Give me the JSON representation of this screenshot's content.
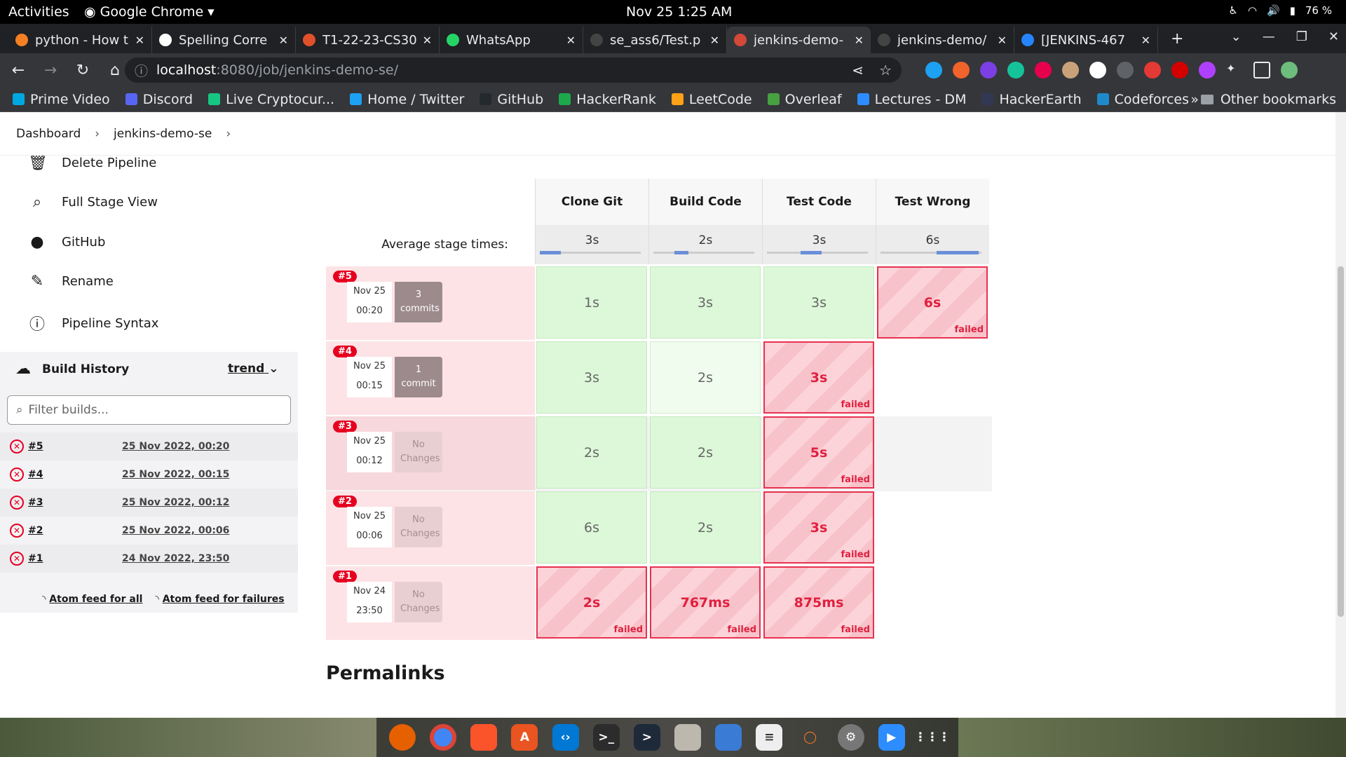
{
  "system": {
    "activities": "Activities",
    "app": "Google Chrome",
    "clock": "Nov 25  1:25 AM",
    "battery": "76 %"
  },
  "tabs": [
    {
      "title": "python - How t",
      "color": "#f48024"
    },
    {
      "title": "Spelling Corre",
      "color": "#ffffff"
    },
    {
      "title": "T1-22-23-CS30",
      "color": "#e0502a"
    },
    {
      "title": "WhatsApp",
      "color": "#25d366"
    },
    {
      "title": "se_ass6/Test.p",
      "color": "#444444"
    },
    {
      "title": "jenkins-demo-",
      "color": "#d24939"
    },
    {
      "title": "jenkins-demo/",
      "color": "#444444"
    },
    {
      "title": "[JENKINS-467",
      "color": "#2684ff"
    }
  ],
  "address": {
    "host": "localhost",
    "rest": ":8080/job/jenkins-demo-se/"
  },
  "bookmarks": [
    {
      "label": "Prime Video",
      "color": "#00a8e1"
    },
    {
      "label": "Discord",
      "color": "#5865f2"
    },
    {
      "label": "Live Cryptocur...",
      "color": "#16c784"
    },
    {
      "label": "Home / Twitter",
      "color": "#1da1f2"
    },
    {
      "label": "GitHub",
      "color": "#24292e"
    },
    {
      "label": "HackerRank",
      "color": "#1ba94c"
    },
    {
      "label": "LeetCode",
      "color": "#ffa116"
    },
    {
      "label": "Overleaf",
      "color": "#47a141"
    },
    {
      "label": "Lectures - DM",
      "color": "#2d8cff"
    },
    {
      "label": "HackerEarth",
      "color": "#323754"
    },
    {
      "label": "Codeforces",
      "color": "#1f8acb"
    }
  ],
  "other_bookmarks": "Other bookmarks",
  "breadcrumb": {
    "dashboard": "Dashboard",
    "job": "jenkins-demo-se"
  },
  "sidebar": {
    "items": [
      {
        "label": "Delete Pipeline",
        "icon": "trash-icon"
      },
      {
        "label": "Full Stage View",
        "icon": "search-icon"
      },
      {
        "label": "GitHub",
        "icon": "github-icon"
      },
      {
        "label": "Rename",
        "icon": "pencil-icon"
      },
      {
        "label": "Pipeline Syntax",
        "icon": "help-icon"
      }
    ]
  },
  "build_history": {
    "title": "Build History",
    "trend": "trend",
    "filter_placeholder": "Filter builds...",
    "builds": [
      {
        "num": "#5",
        "date": "25 Nov 2022, 00:20"
      },
      {
        "num": "#4",
        "date": "25 Nov 2022, 00:15"
      },
      {
        "num": "#3",
        "date": "25 Nov 2022, 00:12"
      },
      {
        "num": "#2",
        "date": "25 Nov 2022, 00:06"
      },
      {
        "num": "#1",
        "date": "24 Nov 2022, 23:50"
      }
    ],
    "feed_all": "Atom feed for all",
    "feed_failures": "Atom feed for failures"
  },
  "stage_view": {
    "stages": [
      "Clone Git",
      "Build Code",
      "Test Code",
      "Test Wrong"
    ],
    "avg_label": "Average stage times:",
    "avg_times": [
      "3s",
      "2s",
      "3s",
      "6s"
    ],
    "failed_label": "failed",
    "runs": [
      {
        "badge": "#5",
        "date": "Nov 25",
        "time": "00:20",
        "changes": "3 commits",
        "has_changes": true,
        "cells": [
          {
            "v": "1s",
            "s": "ok"
          },
          {
            "v": "3s",
            "s": "ok"
          },
          {
            "v": "3s",
            "s": "ok"
          },
          {
            "v": "6s",
            "s": "fail"
          }
        ]
      },
      {
        "badge": "#4",
        "date": "Nov 25",
        "time": "00:15",
        "changes": "1 commit",
        "has_changes": true,
        "cells": [
          {
            "v": "3s",
            "s": "ok"
          },
          {
            "v": "2s",
            "s": "ok2"
          },
          {
            "v": "3s",
            "s": "fail"
          },
          {
            "v": "",
            "s": "empty"
          }
        ]
      },
      {
        "badge": "#3",
        "date": "Nov 25",
        "time": "00:12",
        "changes": "No Changes",
        "has_changes": false,
        "cells": [
          {
            "v": "2s",
            "s": "ok"
          },
          {
            "v": "2s",
            "s": "ok"
          },
          {
            "v": "5s",
            "s": "fail"
          },
          {
            "v": "",
            "s": "emptyg"
          }
        ]
      },
      {
        "badge": "#2",
        "date": "Nov 25",
        "time": "00:06",
        "changes": "No Changes",
        "has_changes": false,
        "cells": [
          {
            "v": "6s",
            "s": "ok"
          },
          {
            "v": "2s",
            "s": "ok"
          },
          {
            "v": "3s",
            "s": "fail"
          },
          {
            "v": "",
            "s": "empty"
          }
        ]
      },
      {
        "badge": "#1",
        "date": "Nov 24",
        "time": "23:50",
        "changes": "No Changes",
        "has_changes": false,
        "cells": [
          {
            "v": "2s",
            "s": "fail"
          },
          {
            "v": "767ms",
            "s": "fail"
          },
          {
            "v": "875ms",
            "s": "fail"
          },
          {
            "v": "",
            "s": "empty"
          }
        ]
      }
    ]
  },
  "permalinks": "Permalinks"
}
